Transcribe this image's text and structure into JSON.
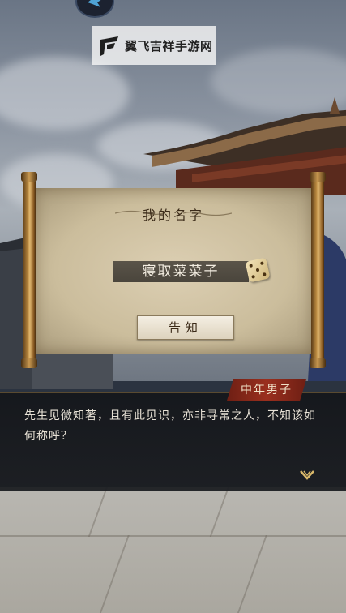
{
  "watermark": {
    "text": "翼飞吉祥手游网"
  },
  "name_dialog": {
    "title": "我的名字",
    "name_value": "寝取菜菜子",
    "confirm_label": "告知",
    "dice_icon": "dice-icon"
  },
  "conversation": {
    "speaker": "中年男子",
    "text": "先生见微知著，且有此见识，亦非寻常之人，不知该如何称呼？",
    "continue_icon": "chevron-down-icon"
  },
  "colors": {
    "speaker_tag": "#9a2f1e",
    "dialog_bg": "#1c1e22",
    "paper": "#d6c8aa",
    "rod_gold": "#c89850"
  }
}
